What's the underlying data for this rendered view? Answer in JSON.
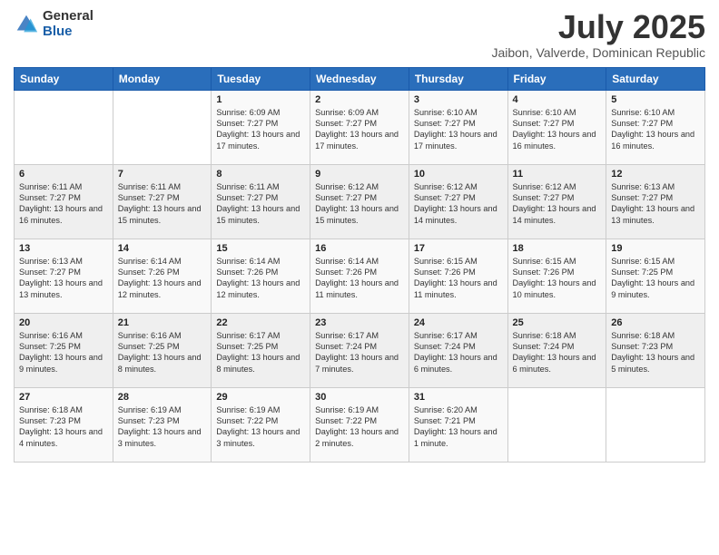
{
  "logo": {
    "general": "General",
    "blue": "Blue"
  },
  "header": {
    "title": "July 2025",
    "subtitle": "Jaibon, Valverde, Dominican Republic"
  },
  "weekdays": [
    "Sunday",
    "Monday",
    "Tuesday",
    "Wednesday",
    "Thursday",
    "Friday",
    "Saturday"
  ],
  "weeks": [
    [
      {
        "day": "",
        "info": ""
      },
      {
        "day": "",
        "info": ""
      },
      {
        "day": "1",
        "info": "Sunrise: 6:09 AM\nSunset: 7:27 PM\nDaylight: 13 hours and 17 minutes."
      },
      {
        "day": "2",
        "info": "Sunrise: 6:09 AM\nSunset: 7:27 PM\nDaylight: 13 hours and 17 minutes."
      },
      {
        "day": "3",
        "info": "Sunrise: 6:10 AM\nSunset: 7:27 PM\nDaylight: 13 hours and 17 minutes."
      },
      {
        "day": "4",
        "info": "Sunrise: 6:10 AM\nSunset: 7:27 PM\nDaylight: 13 hours and 16 minutes."
      },
      {
        "day": "5",
        "info": "Sunrise: 6:10 AM\nSunset: 7:27 PM\nDaylight: 13 hours and 16 minutes."
      }
    ],
    [
      {
        "day": "6",
        "info": "Sunrise: 6:11 AM\nSunset: 7:27 PM\nDaylight: 13 hours and 16 minutes."
      },
      {
        "day": "7",
        "info": "Sunrise: 6:11 AM\nSunset: 7:27 PM\nDaylight: 13 hours and 15 minutes."
      },
      {
        "day": "8",
        "info": "Sunrise: 6:11 AM\nSunset: 7:27 PM\nDaylight: 13 hours and 15 minutes."
      },
      {
        "day": "9",
        "info": "Sunrise: 6:12 AM\nSunset: 7:27 PM\nDaylight: 13 hours and 15 minutes."
      },
      {
        "day": "10",
        "info": "Sunrise: 6:12 AM\nSunset: 7:27 PM\nDaylight: 13 hours and 14 minutes."
      },
      {
        "day": "11",
        "info": "Sunrise: 6:12 AM\nSunset: 7:27 PM\nDaylight: 13 hours and 14 minutes."
      },
      {
        "day": "12",
        "info": "Sunrise: 6:13 AM\nSunset: 7:27 PM\nDaylight: 13 hours and 13 minutes."
      }
    ],
    [
      {
        "day": "13",
        "info": "Sunrise: 6:13 AM\nSunset: 7:27 PM\nDaylight: 13 hours and 13 minutes."
      },
      {
        "day": "14",
        "info": "Sunrise: 6:14 AM\nSunset: 7:26 PM\nDaylight: 13 hours and 12 minutes."
      },
      {
        "day": "15",
        "info": "Sunrise: 6:14 AM\nSunset: 7:26 PM\nDaylight: 13 hours and 12 minutes."
      },
      {
        "day": "16",
        "info": "Sunrise: 6:14 AM\nSunset: 7:26 PM\nDaylight: 13 hours and 11 minutes."
      },
      {
        "day": "17",
        "info": "Sunrise: 6:15 AM\nSunset: 7:26 PM\nDaylight: 13 hours and 11 minutes."
      },
      {
        "day": "18",
        "info": "Sunrise: 6:15 AM\nSunset: 7:26 PM\nDaylight: 13 hours and 10 minutes."
      },
      {
        "day": "19",
        "info": "Sunrise: 6:15 AM\nSunset: 7:25 PM\nDaylight: 13 hours and 9 minutes."
      }
    ],
    [
      {
        "day": "20",
        "info": "Sunrise: 6:16 AM\nSunset: 7:25 PM\nDaylight: 13 hours and 9 minutes."
      },
      {
        "day": "21",
        "info": "Sunrise: 6:16 AM\nSunset: 7:25 PM\nDaylight: 13 hours and 8 minutes."
      },
      {
        "day": "22",
        "info": "Sunrise: 6:17 AM\nSunset: 7:25 PM\nDaylight: 13 hours and 8 minutes."
      },
      {
        "day": "23",
        "info": "Sunrise: 6:17 AM\nSunset: 7:24 PM\nDaylight: 13 hours and 7 minutes."
      },
      {
        "day": "24",
        "info": "Sunrise: 6:17 AM\nSunset: 7:24 PM\nDaylight: 13 hours and 6 minutes."
      },
      {
        "day": "25",
        "info": "Sunrise: 6:18 AM\nSunset: 7:24 PM\nDaylight: 13 hours and 6 minutes."
      },
      {
        "day": "26",
        "info": "Sunrise: 6:18 AM\nSunset: 7:23 PM\nDaylight: 13 hours and 5 minutes."
      }
    ],
    [
      {
        "day": "27",
        "info": "Sunrise: 6:18 AM\nSunset: 7:23 PM\nDaylight: 13 hours and 4 minutes."
      },
      {
        "day": "28",
        "info": "Sunrise: 6:19 AM\nSunset: 7:23 PM\nDaylight: 13 hours and 3 minutes."
      },
      {
        "day": "29",
        "info": "Sunrise: 6:19 AM\nSunset: 7:22 PM\nDaylight: 13 hours and 3 minutes."
      },
      {
        "day": "30",
        "info": "Sunrise: 6:19 AM\nSunset: 7:22 PM\nDaylight: 13 hours and 2 minutes."
      },
      {
        "day": "31",
        "info": "Sunrise: 6:20 AM\nSunset: 7:21 PM\nDaylight: 13 hours and 1 minute."
      },
      {
        "day": "",
        "info": ""
      },
      {
        "day": "",
        "info": ""
      }
    ]
  ]
}
